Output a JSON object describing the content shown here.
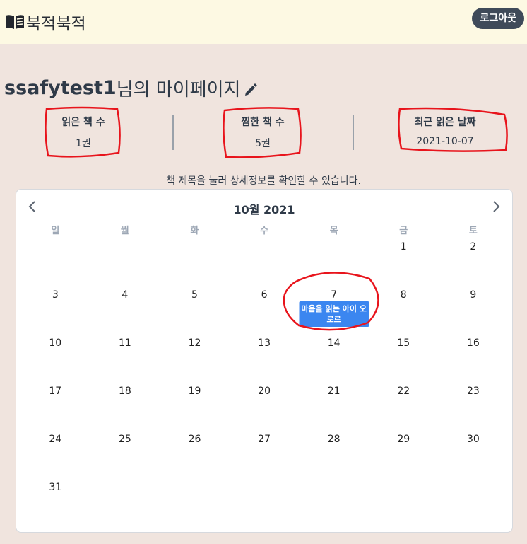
{
  "header": {
    "brand": "북적북적",
    "brand_icon": "book-open-icon",
    "logout_label": "로그아웃"
  },
  "page": {
    "username": "ssafytest1",
    "title_suffix": "님의 마이페이지",
    "edit_icon": "pencil-icon"
  },
  "stats": [
    {
      "label": "읽은 책 수",
      "value": "1권"
    },
    {
      "label": "찜한 책 수",
      "value": "5권"
    },
    {
      "label": "최근 읽은 날짜",
      "value": "2021-10-07"
    }
  ],
  "hint": "책 제목을 눌러 상세정보를 확인할 수 있습니다.",
  "calendar": {
    "title": "10월 2021",
    "weekdays": [
      "일",
      "월",
      "화",
      "수",
      "목",
      "금",
      "토"
    ],
    "weeks": [
      [
        "",
        "",
        "",
        "",
        "",
        "1",
        "2"
      ],
      [
        "3",
        "4",
        "5",
        "6",
        "7",
        "8",
        "9"
      ],
      [
        "10",
        "11",
        "12",
        "13",
        "14",
        "15",
        "16"
      ],
      [
        "17",
        "18",
        "19",
        "20",
        "21",
        "22",
        "23"
      ],
      [
        "24",
        "25",
        "26",
        "27",
        "28",
        "29",
        "30"
      ],
      [
        "31",
        "",
        "",
        "",
        "",
        "",
        ""
      ]
    ],
    "event": {
      "date": "7",
      "title": "마음을 읽는 아이 오로르"
    }
  },
  "colors": {
    "background": "#f0e4de",
    "header_bg": "#fdf9e3",
    "logout_bg": "#3f4a59",
    "event_bg": "#3b86f0",
    "annotation": "#e8141c"
  }
}
